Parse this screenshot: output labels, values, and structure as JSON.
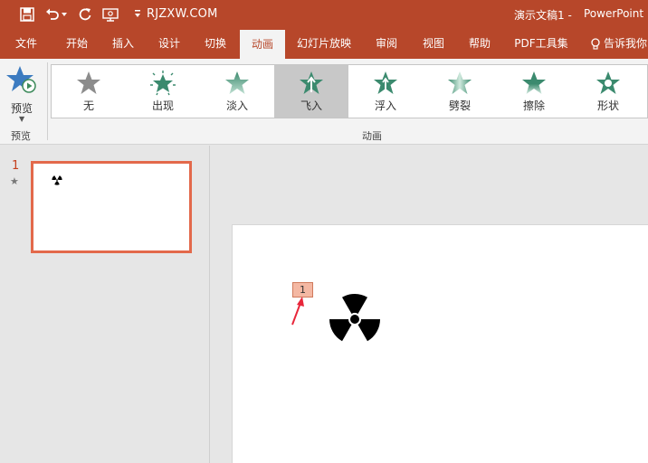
{
  "titlebar": {
    "site": "RJZXW.COM",
    "doc_title": "演示文稿1",
    "separator": "-",
    "app_name": "PowerPoint",
    "icons": [
      "save-icon",
      "undo-icon",
      "redo-icon",
      "present-from-start-icon",
      "customize-toolbar-icon"
    ]
  },
  "tabs": [
    {
      "label": "文件"
    },
    {
      "label": "开始"
    },
    {
      "label": "插入"
    },
    {
      "label": "设计"
    },
    {
      "label": "切换"
    },
    {
      "label": "动画"
    },
    {
      "label": "幻灯片放映"
    },
    {
      "label": "审阅"
    },
    {
      "label": "视图"
    },
    {
      "label": "帮助"
    },
    {
      "label": "PDF工具集"
    }
  ],
  "active_tab": "动画",
  "tell_me": "告诉我你",
  "ribbon": {
    "preview": {
      "label": "预览",
      "group_label": "预览"
    },
    "animation_group_label": "动画",
    "animations": [
      {
        "label": "无"
      },
      {
        "label": "出现"
      },
      {
        "label": "淡入"
      },
      {
        "label": "飞入",
        "selected": true
      },
      {
        "label": "浮入"
      },
      {
        "label": "劈裂"
      },
      {
        "label": "擦除"
      },
      {
        "label": "形状"
      }
    ]
  },
  "thumbnails": [
    {
      "number": "1",
      "has_animation": "★"
    }
  ],
  "slide": {
    "animation_tag": "1"
  },
  "colors": {
    "accent": "#b7472a",
    "selection": "#e3694b",
    "tag_fill": "#f4b8a3",
    "star_green": "#3b8a6e",
    "arrow_red": "#e8263a"
  }
}
